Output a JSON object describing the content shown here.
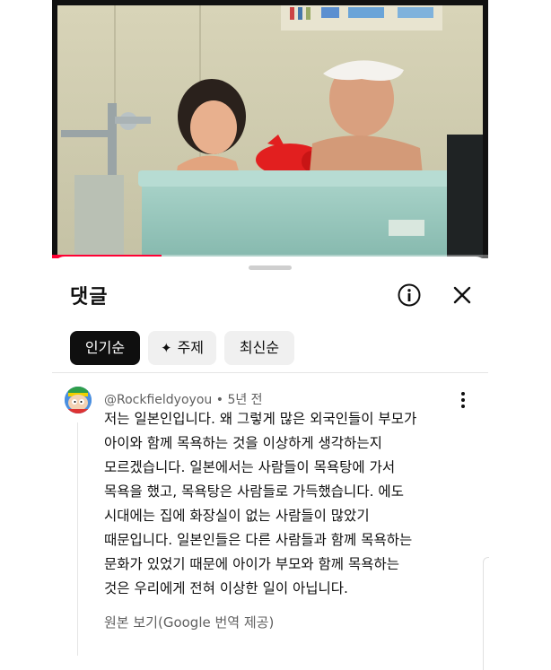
{
  "video": {
    "progress_fraction": 0.25,
    "progress_color": "#ff0033"
  },
  "comments_panel": {
    "title": "댓글",
    "info_icon": "info-icon",
    "close_icon": "close-icon",
    "chips": [
      {
        "label": "인기순",
        "active": true
      },
      {
        "label": "주제",
        "active": false,
        "icon": "sparkle-icon"
      },
      {
        "label": "최신순",
        "active": false
      }
    ]
  },
  "comment": {
    "author": "@Rockfieldyoyou",
    "separator": "•",
    "time": "5년 전",
    "lines": [
      "저는 일본인입니다. 왜 그렇게 많은 외국인들이 부모가",
      "아이와 함께 목욕하는 것을 이상하게 생각하는지",
      "모르겠습니다. 일본에서는 사람들이 목욕탕에 가서",
      "목욕을 했고, 목욕탕은 사람들로 가득했습니다. 에도",
      "시대에는 집에 화장실이 없는 사람들이 많았기",
      "때문입니다. 일본인들은 다른 사람들과 함께 목욕하는",
      "문화가 있었기 때문에 아이가 부모와 함께 목욕하는",
      "것은 우리에게 전혀 이상한 일이 아닙니다."
    ],
    "translate_label": "원본 보기(Google 번역 제공)",
    "more_icon": "more-vert-icon"
  }
}
